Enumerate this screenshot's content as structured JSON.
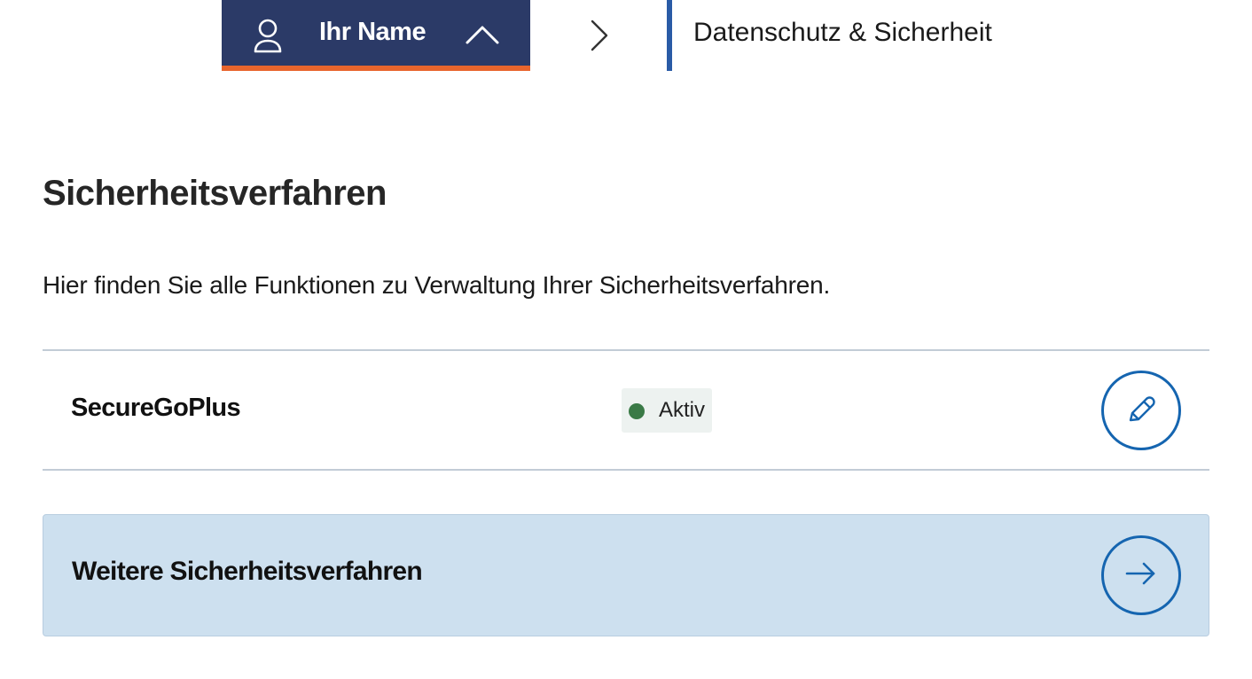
{
  "header": {
    "user_name": "Ihr Name",
    "breadcrumb_current": "Datenschutz & Sicherheit"
  },
  "section": {
    "title": "Sicherheitsverfahren",
    "intro": "Hier finden Sie alle Funktionen zu Verwaltung Ihrer Sicherheitsverfahren."
  },
  "methods": [
    {
      "name": "SecureGoPlus",
      "status": "Aktiv",
      "action_icon": "pencil-icon"
    }
  ],
  "more": {
    "label": "Weitere Sicherheitsverfahren",
    "action_icon": "arrow-right-icon"
  },
  "colors": {
    "header_bg": "#2b3a67",
    "header_accent": "#e8652d",
    "breadcrumb_accent": "#2a5ba6",
    "action_blue": "#1565b0",
    "status_active": "#3a7a46",
    "panel_bg": "#cde0ef"
  }
}
